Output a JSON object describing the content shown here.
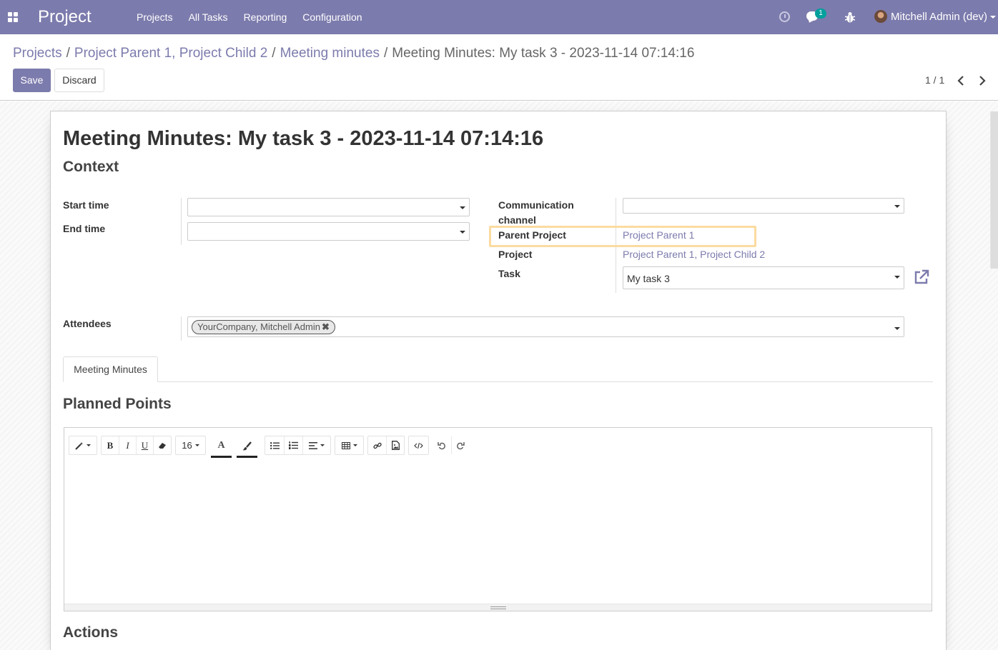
{
  "navbar": {
    "app_name": "Project",
    "menu": [
      "Projects",
      "All Tasks",
      "Reporting",
      "Configuration"
    ],
    "chat_count": "1",
    "user_name": "Mitchell Admin (dev)",
    "icons": [
      "apps-icon",
      "clock-icon",
      "chat-icon",
      "bug-icon",
      "avatar"
    ],
    "color": "#7c7bad"
  },
  "breadcrumb": {
    "items": [
      "Projects",
      "Project Parent 1, Project Child 2",
      "Meeting minutes"
    ],
    "current": "Meeting Minutes: My task 3 - 2023-11-14 07:14:16",
    "separator": "/"
  },
  "actions": {
    "save": "Save",
    "discard": "Discard"
  },
  "pager": {
    "value": "1 / 1"
  },
  "form": {
    "title": "Meeting Minutes: My task 3 - 2023-11-14 07:14:16",
    "section_context": "Context",
    "fields": {
      "start_time": {
        "label": "Start time",
        "value": ""
      },
      "end_time": {
        "label": "End time",
        "value": ""
      },
      "communication_channel": {
        "label": "Communication channel",
        "value": ""
      },
      "parent_project": {
        "label": "Parent Project",
        "value": "Project Parent 1"
      },
      "project": {
        "label": "Project",
        "value": "Project Parent 1, Project Child 2"
      },
      "task": {
        "label": "Task",
        "value": "My task 3"
      },
      "attendees": {
        "label": "Attendees",
        "tags": [
          "YourCompany, Mitchell Admin"
        ]
      }
    },
    "tabs": [
      "Meeting Minutes"
    ],
    "section_planned": "Planned Points",
    "section_actions": "Actions",
    "highlight_color": "#fbdba0"
  },
  "editor": {
    "font_size": "16",
    "toolbar": [
      "style",
      "bold",
      "italic",
      "underline",
      "eraser",
      "font-size",
      "font-color",
      "background-color",
      "unordered-list",
      "ordered-list",
      "paragraph-align",
      "table",
      "link",
      "picture",
      "code-view",
      "undo",
      "redo"
    ],
    "bold_label": "B",
    "italic_label": "I",
    "underline_label": "U",
    "color_label": "A"
  }
}
